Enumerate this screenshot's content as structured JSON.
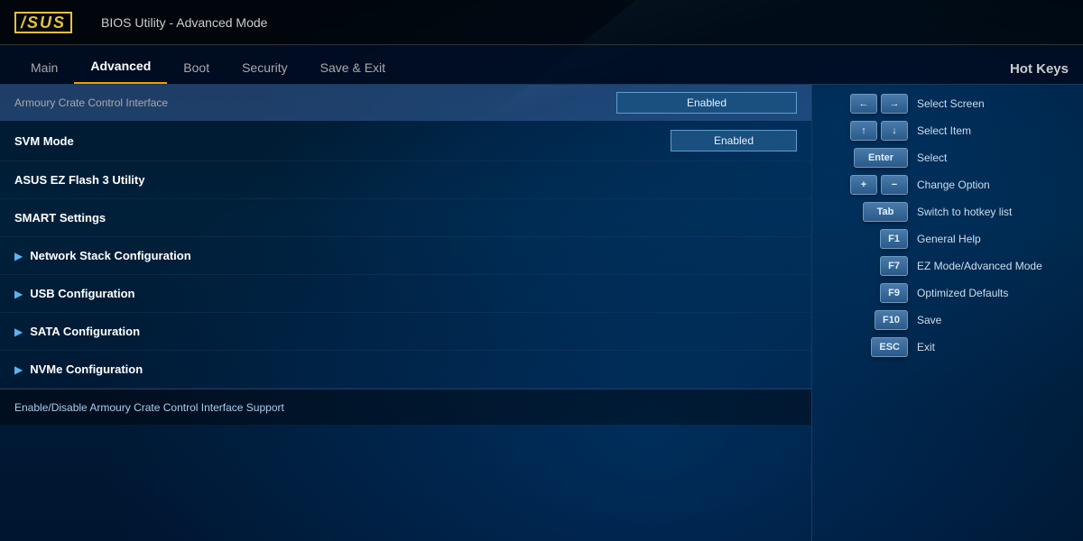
{
  "header": {
    "logo": "/SUS",
    "title": "BIOS Utility - Advanced Mode"
  },
  "navbar": {
    "items": [
      {
        "id": "main",
        "label": "Main",
        "active": false
      },
      {
        "id": "advanced",
        "label": "Advanced",
        "active": true
      },
      {
        "id": "boot",
        "label": "Boot",
        "active": false
      },
      {
        "id": "security",
        "label": "Security",
        "active": false
      },
      {
        "id": "save-exit",
        "label": "Save & Exit",
        "active": false
      }
    ],
    "hotkeys_label": "Hot Keys"
  },
  "settings": {
    "highlighted_row": {
      "label": "Armoury Crate Control Interface",
      "value": "Enabled"
    },
    "rows": [
      {
        "id": "svm-mode",
        "label": "SVM Mode",
        "value": "Enabled",
        "has_arrow": false,
        "has_value": true
      },
      {
        "id": "asus-ez-flash",
        "label": "ASUS EZ Flash 3 Utility",
        "value": "",
        "has_arrow": false,
        "has_value": false
      },
      {
        "id": "smart-settings",
        "label": "SMART Settings",
        "value": "",
        "has_arrow": false,
        "has_value": false
      },
      {
        "id": "network-stack",
        "label": "Network Stack Configuration",
        "value": "",
        "has_arrow": true,
        "has_value": false
      },
      {
        "id": "usb-config",
        "label": "USB Configuration",
        "value": "",
        "has_arrow": true,
        "has_value": false
      },
      {
        "id": "sata-config",
        "label": "SATA Configuration",
        "value": "",
        "has_arrow": true,
        "has_value": false
      },
      {
        "id": "nvme-config",
        "label": "NVMe Configuration",
        "value": "",
        "has_arrow": true,
        "has_value": false
      }
    ]
  },
  "footer": {
    "description": "Enable/Disable Armoury Crate Control Interface Support"
  },
  "hotkeys": [
    {
      "id": "select-screen",
      "keys": [
        "←",
        "→"
      ],
      "description": "Select Screen",
      "separator": true
    },
    {
      "id": "select-item",
      "keys": [
        "↑",
        "↓"
      ],
      "description": "Select Item",
      "separator": true
    },
    {
      "id": "select",
      "keys": [
        "Enter"
      ],
      "description": "Select",
      "separator": false
    },
    {
      "id": "change-option",
      "keys": [
        "+",
        "−"
      ],
      "description": "Change Option",
      "separator": true
    },
    {
      "id": "hotkey-list",
      "keys": [
        "Tab"
      ],
      "description": "Switch to hotkey list",
      "separator": false
    },
    {
      "id": "general-help",
      "keys": [
        "F1"
      ],
      "description": "General Help",
      "separator": false
    },
    {
      "id": "ez-mode",
      "keys": [
        "F7"
      ],
      "description": "EZ Mode/Advanced Mode",
      "separator": false
    },
    {
      "id": "optimized",
      "keys": [
        "F9"
      ],
      "description": "Optimized Defaults",
      "separator": false
    },
    {
      "id": "save",
      "keys": [
        "F10"
      ],
      "description": "Save",
      "separator": false
    },
    {
      "id": "exit",
      "keys": [
        "ESC"
      ],
      "description": "Exit",
      "separator": false
    }
  ]
}
